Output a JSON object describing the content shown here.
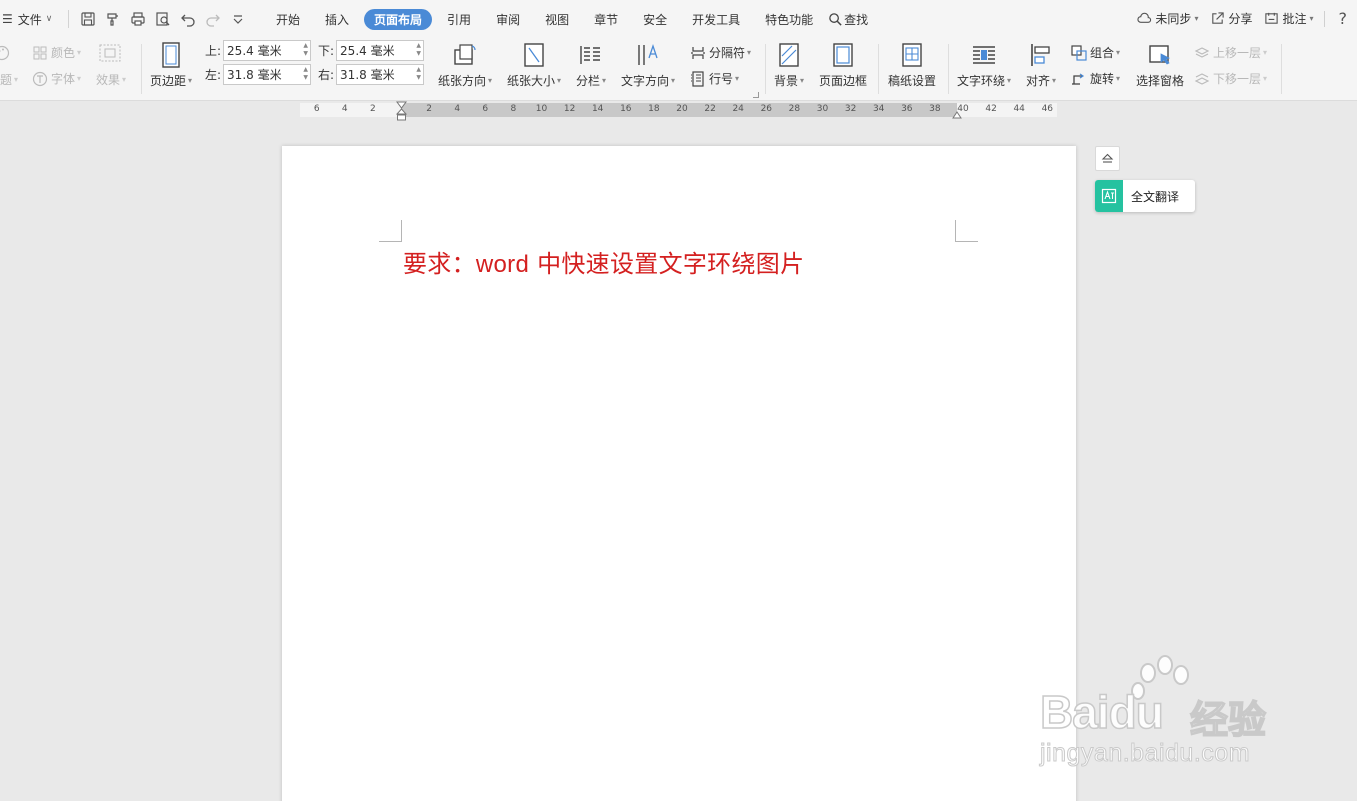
{
  "menubar": {
    "file_label": "文件",
    "tabs": [
      "开始",
      "插入",
      "页面布局",
      "引用",
      "审阅",
      "视图",
      "章节",
      "安全",
      "开发工具",
      "特色功能"
    ],
    "active_tab_index": 2,
    "search_label": "查找",
    "sync_label": "未同步",
    "share_label": "分享",
    "comment_label": "批注",
    "help_label": "?"
  },
  "ribbon": {
    "theme_label": "题",
    "color_label": "颜色",
    "font_label": "字体",
    "effect_label": "效果",
    "margins_label": "页边距",
    "top_label": "上:",
    "top_value": "25.4 毫米",
    "bottom_label": "下:",
    "bottom_value": "25.4 毫米",
    "left_label": "左:",
    "left_value": "31.8 毫米",
    "right_label": "右:",
    "right_value": "31.8 毫米",
    "orientation_label": "纸张方向",
    "size_label": "纸张大小",
    "columns_label": "分栏",
    "text_direction_label": "文字方向",
    "separator_label": "分隔符",
    "line_number_label": "行号",
    "background_label": "背景",
    "page_border_label": "页面边框",
    "manuscript_label": "稿纸设置",
    "text_wrap_label": "文字环绕",
    "align_label": "对齐",
    "group_label": "组合",
    "rotate_label": "旋转",
    "selection_pane_label": "选择窗格",
    "bring_forward_label": "上移一层",
    "send_backward_label": "下移一层"
  },
  "ruler": {
    "ticks_left": [
      "6",
      "4",
      "2"
    ],
    "ticks_main": [
      "2",
      "4",
      "6",
      "8",
      "10",
      "12",
      "14",
      "16",
      "18",
      "20",
      "22",
      "24",
      "26",
      "28",
      "30",
      "32",
      "34",
      "36",
      "38",
      "40"
    ],
    "ticks_right": [
      "42",
      "44",
      "46"
    ]
  },
  "document": {
    "text_cn_before": "要求：",
    "text_latin": "word",
    "text_cn_after": " 中快速设置文字环绕图片",
    "text_color": "#d42020"
  },
  "side_panel": {
    "translate_label": "全文翻译",
    "translate_color": "#25c2a0"
  },
  "watermark": {
    "brand_latin": "Bai",
    "brand_du": "du",
    "brand_cn": "经验",
    "url": "jingyan.baidu.com"
  },
  "colors": {
    "accent": "#4a8ad6",
    "background": "#e9e9e9"
  }
}
